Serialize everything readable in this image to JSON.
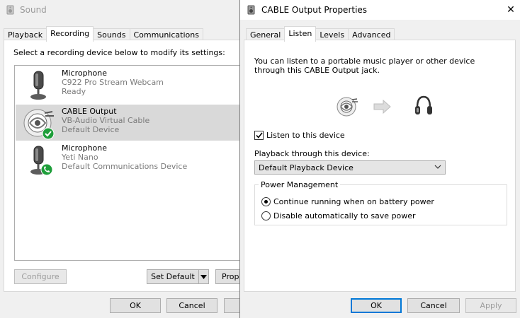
{
  "sound": {
    "title": "Sound",
    "tabs": [
      "Playback",
      "Recording",
      "Sounds",
      "Communications"
    ],
    "active_tab": "Recording",
    "instruction": "Select a recording device below to modify its settings:",
    "devices": [
      {
        "name": "Microphone",
        "model": "C922 Pro Stream Webcam",
        "status": "Ready",
        "icon": "microphone-icon",
        "badge": "",
        "selected": false
      },
      {
        "name": "CABLE Output",
        "model": "VB-Audio Virtual Cable",
        "status": "Default Device",
        "icon": "cable-icon",
        "badge": "default-check-badge",
        "selected": true
      },
      {
        "name": "Microphone",
        "model": "Yeti Nano",
        "status": "Default Communications Device",
        "icon": "microphone-icon",
        "badge": "phone-badge",
        "selected": false
      }
    ],
    "buttons": {
      "configure": "Configure",
      "set_default": "Set Default",
      "properties": "Prop",
      "ok": "OK",
      "cancel": "Cancel"
    }
  },
  "props": {
    "title": "CABLE Output Properties",
    "close_glyph": "✕",
    "tabs": [
      "General",
      "Listen",
      "Levels",
      "Advanced"
    ],
    "active_tab": "Listen",
    "description": "You can listen to a portable music player or other device through this CABLE Output jack.",
    "listen_checkbox": {
      "label": "Listen to this device",
      "checked": true
    },
    "playback_label": "Playback through this device:",
    "playback_value": "Default Playback Device",
    "power_group": {
      "title": "Power Management",
      "options": [
        {
          "label": "Continue running when on battery power",
          "selected": true
        },
        {
          "label": "Disable automatically to save power",
          "selected": false
        }
      ]
    },
    "buttons": {
      "ok": "OK",
      "cancel": "Cancel",
      "apply": "Apply"
    }
  },
  "colors": {
    "accent": "#0078d7",
    "badge_green": "#1e9e3a",
    "selected_row": "#d9d9d9"
  }
}
